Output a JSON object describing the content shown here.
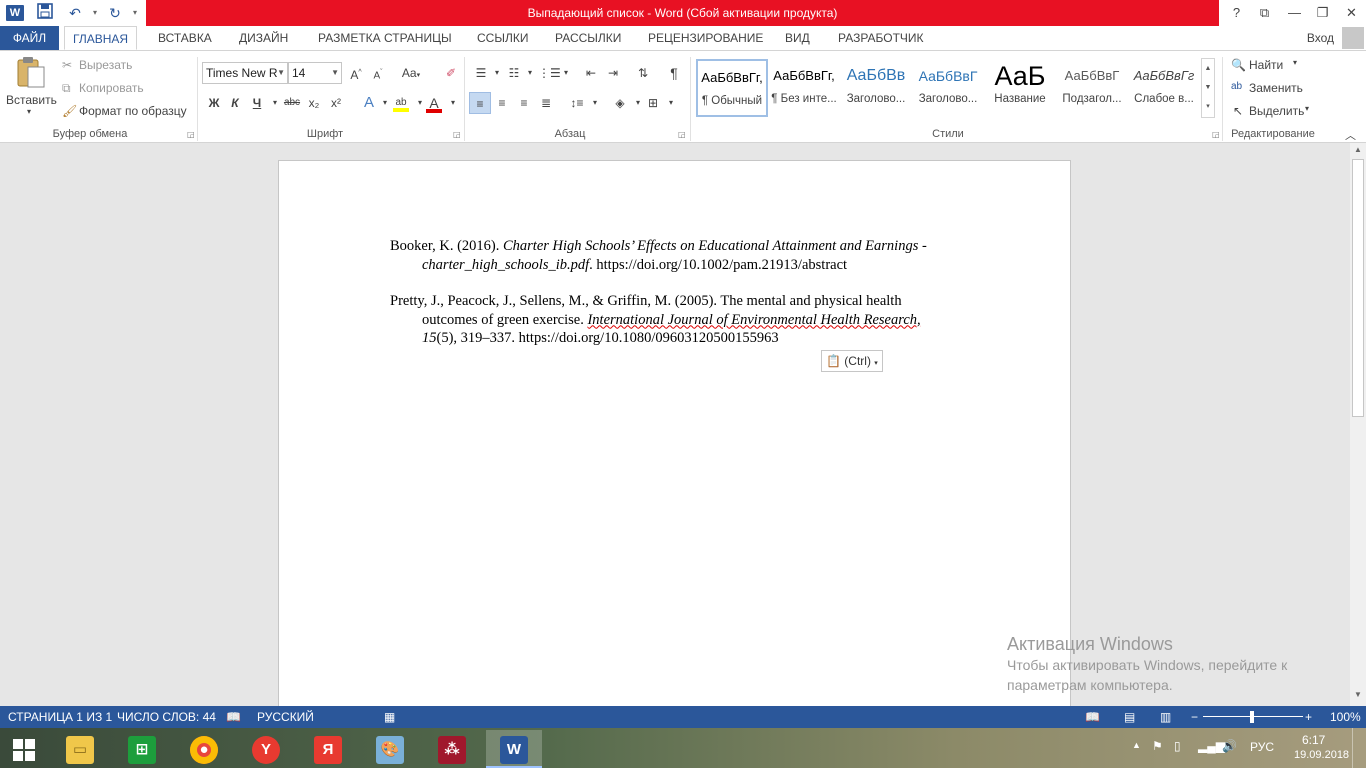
{
  "window": {
    "title": "Выпадающий список -  Word (Сбой активации продукта)",
    "help": "?",
    "ribbon_display": "⧉",
    "minimize": "—",
    "restore": "❐",
    "close": "✕"
  },
  "quick_access": {
    "app_icon": "W",
    "save_icon": "floppy-icon",
    "undo_icon": "undo-icon",
    "redo_icon": "redo-icon"
  },
  "tabs": [
    "ФАЙЛ",
    "ГЛАВНАЯ",
    "ВСТАВКА",
    "ДИЗАЙН",
    "РАЗМЕТКА СТРАНИЦЫ",
    "ССЫЛКИ",
    "РАССЫЛКИ",
    "РЕЦЕНЗИРОВАНИЕ",
    "ВИД",
    "РАЗРАБОТЧИК"
  ],
  "active_tab": "ГЛАВНАЯ",
  "login": "Вход",
  "clipboard": {
    "paste": "Вставить",
    "cut": "Вырезать",
    "copy": "Копировать",
    "format_painter": "Формат по образцу",
    "label": "Буфер обмена"
  },
  "font": {
    "name": "Times New R",
    "size": "14",
    "label": "Шрифт",
    "grow": "A",
    "shrink": "A",
    "case": "Aa",
    "bold": "Ж",
    "italic": "К",
    "underline": "Ч",
    "strike": "abc",
    "subscript": "x₂",
    "superscript": "x²",
    "effects": "A",
    "highlight": "ab",
    "color": "A",
    "highlight_color": "#ffff00",
    "font_color": "#e00000"
  },
  "paragraph": {
    "label": "Абзац",
    "show_marks": "¶"
  },
  "styles": {
    "label": "Стили",
    "items": [
      {
        "preview": "АаБбВвГг,",
        "name": "¶ Обычный"
      },
      {
        "preview": "АаБбВвГг,",
        "name": "¶ Без инте..."
      },
      {
        "preview": "АаБбВв",
        "name": "Заголово..."
      },
      {
        "preview": "АаБбВвГ",
        "name": "Заголово..."
      },
      {
        "preview": "АаБ",
        "name": "Название"
      },
      {
        "preview": "АаБбВвГ",
        "name": "Подзагол..."
      },
      {
        "preview": "АаБбВвГг",
        "name": "Слабое в..."
      }
    ]
  },
  "editing": {
    "label": "Редактирование",
    "find": "Найти",
    "replace": "Заменить",
    "select": "Выделить"
  },
  "document": {
    "ref1": {
      "authors": "Booker, K. (2016). ",
      "title_a": "Charter High Schools’ Effects on Educational Attainment and Earnings -",
      "title_b": "charter_high_schools_ib.pdf",
      "rest": ". https://doi.org/10.1002/pam.21913/abstract"
    },
    "ref2": {
      "line1": "Pretty, J., Peacock, J., Sellens, M., & Griffin, M. (2005). The mental and physical health",
      "line2a": "outcomes of green exercise. ",
      "journal": "International Journal of Environmental Health Research,",
      "volume": "15",
      "rest": "(5), 319–337. https://doi.org/10.1080/09603120500155963"
    },
    "paste_options": "(Ctrl)"
  },
  "watermark": {
    "title": "Активация Windows",
    "line1": "Чтобы активировать Windows, перейдите к",
    "line2": "параметрам компьютера."
  },
  "status": {
    "page": "СТРАНИЦА 1 ИЗ 1",
    "words": "ЧИСЛО СЛОВ: 44",
    "language": "РУССКИЙ",
    "zoom": "100%",
    "zoom_level": 1.0
  },
  "taskbar": {
    "apps": [
      "windows-start",
      "file-explorer",
      "store",
      "chrome",
      "yandex-browser",
      "yandex",
      "paint",
      "mendeley",
      "word"
    ],
    "lang": "РУС",
    "time": "6:17",
    "date": "19.09.2018"
  }
}
